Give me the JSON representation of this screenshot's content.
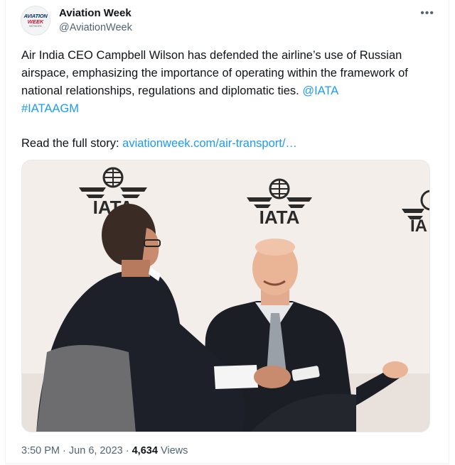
{
  "account": {
    "display_name": "Aviation Week",
    "handle": "@AviationWeek",
    "avatar_line1": "AVIATION",
    "avatar_line2": "WEEK",
    "avatar_line3": "NETWORK"
  },
  "tweet": {
    "text_main": "Air India CEO Campbell Wilson has defended the airline’s use of Russian airspace, emphasizing the importance of operating within the framework of national relationships, regulations and diplomatic ties. ",
    "mention": "@IATA",
    "hashtag": "#IATAAGM",
    "story_prefix": "Read the full story: ",
    "story_link": "aviationweek.com/air-transport/…",
    "time": "3:50 PM",
    "date": "Jun 6, 2023",
    "separator": "·",
    "views_count": "4,634",
    "views_label": "Views"
  },
  "media": {
    "backdrop_logo_text": [
      "IATA",
      "IATA",
      "IA"
    ]
  },
  "colors": {
    "link": "#1d9bf0",
    "secondary_text": "#536471",
    "primary_text": "#0f1419"
  },
  "icons": {
    "more": "more-horizontal-icon"
  }
}
